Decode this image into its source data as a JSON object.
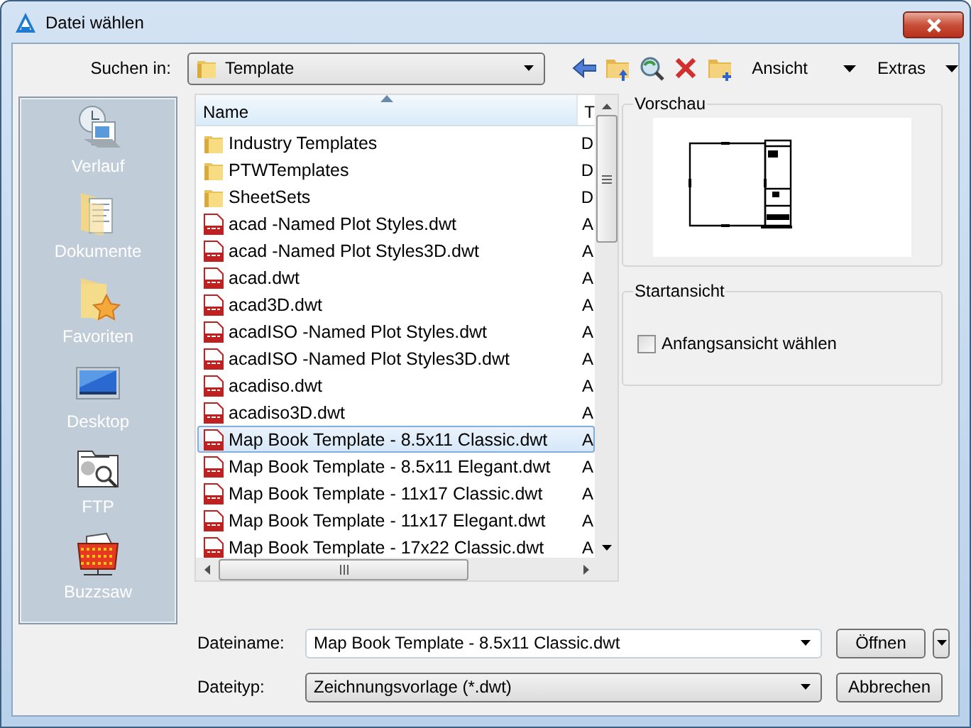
{
  "window": {
    "title": "Datei wählen"
  },
  "look_in": {
    "label": "Suchen in:",
    "value": "Template"
  },
  "toolbar": {
    "tools": [
      {
        "kind": "back"
      },
      {
        "kind": "up"
      },
      {
        "kind": "web"
      },
      {
        "kind": "delete"
      },
      {
        "kind": "newfolder"
      }
    ],
    "menus": [
      {
        "label": "Ansicht"
      },
      {
        "label": "Extras"
      }
    ]
  },
  "places": [
    {
      "label": "Verlauf",
      "kind": "history"
    },
    {
      "label": "Dokumente",
      "kind": "documents"
    },
    {
      "label": "Favoriten",
      "kind": "favorites"
    },
    {
      "label": "Desktop",
      "kind": "desktop"
    },
    {
      "label": "FTP",
      "kind": "ftp"
    },
    {
      "label": "Buzzsaw",
      "kind": "buzzsaw"
    }
  ],
  "file_list": {
    "columns": [
      {
        "label": "Name",
        "sorted": true
      },
      {
        "label": "T",
        "sorted": false
      }
    ],
    "rows": [
      {
        "name": "Industry Templates",
        "column_2": "D",
        "kind": "folder",
        "selected": false
      },
      {
        "name": "PTWTemplates",
        "column_2": "D",
        "kind": "folder",
        "selected": false
      },
      {
        "name": "SheetSets",
        "column_2": "D",
        "kind": "folder",
        "selected": false
      },
      {
        "name": "acad -Named Plot Styles.dwt",
        "column_2": "A",
        "kind": "dwt",
        "selected": false
      },
      {
        "name": "acad -Named Plot Styles3D.dwt",
        "column_2": "A",
        "kind": "dwt",
        "selected": false
      },
      {
        "name": "acad.dwt",
        "column_2": "A",
        "kind": "dwt",
        "selected": false
      },
      {
        "name": "acad3D.dwt",
        "column_2": "A",
        "kind": "dwt",
        "selected": false
      },
      {
        "name": "acadISO -Named Plot Styles.dwt",
        "column_2": "A",
        "kind": "dwt",
        "selected": false
      },
      {
        "name": "acadISO -Named Plot Styles3D.dwt",
        "column_2": "A",
        "kind": "dwt",
        "selected": false
      },
      {
        "name": "acadiso.dwt",
        "column_2": "A",
        "kind": "dwt",
        "selected": false
      },
      {
        "name": "acadiso3D.dwt",
        "column_2": "A",
        "kind": "dwt",
        "selected": false
      },
      {
        "name": "Map Book Template - 8.5x11 Classic.dwt",
        "column_2": "A",
        "kind": "dwt",
        "selected": true
      },
      {
        "name": "Map Book Template - 8.5x11 Elegant.dwt",
        "column_2": "A",
        "kind": "dwt",
        "selected": false
      },
      {
        "name": "Map Book Template - 11x17 Classic.dwt",
        "column_2": "A",
        "kind": "dwt",
        "selected": false
      },
      {
        "name": "Map Book Template - 11x17 Elegant.dwt",
        "column_2": "A",
        "kind": "dwt",
        "selected": false
      },
      {
        "name": "Map Book Template - 17x22 Classic.dwt",
        "column_2": "A",
        "kind": "dwt",
        "selected": false
      }
    ]
  },
  "preview": {
    "title": "Vorschau"
  },
  "start_view": {
    "title": "Startansicht",
    "checkbox": {
      "label": "Anfangsansicht wählen",
      "checked": false
    }
  },
  "file_name": {
    "label": "Dateiname:",
    "value": "Map Book Template - 8.5x11 Classic.dwt"
  },
  "file_type": {
    "label": "Dateityp:",
    "value": "Zeichnungsvorlage (*.dwt)"
  },
  "buttons": [
    {
      "label": "Öffnen",
      "kind": "split"
    },
    {
      "label": "Abbrechen",
      "kind": "plain"
    }
  ]
}
